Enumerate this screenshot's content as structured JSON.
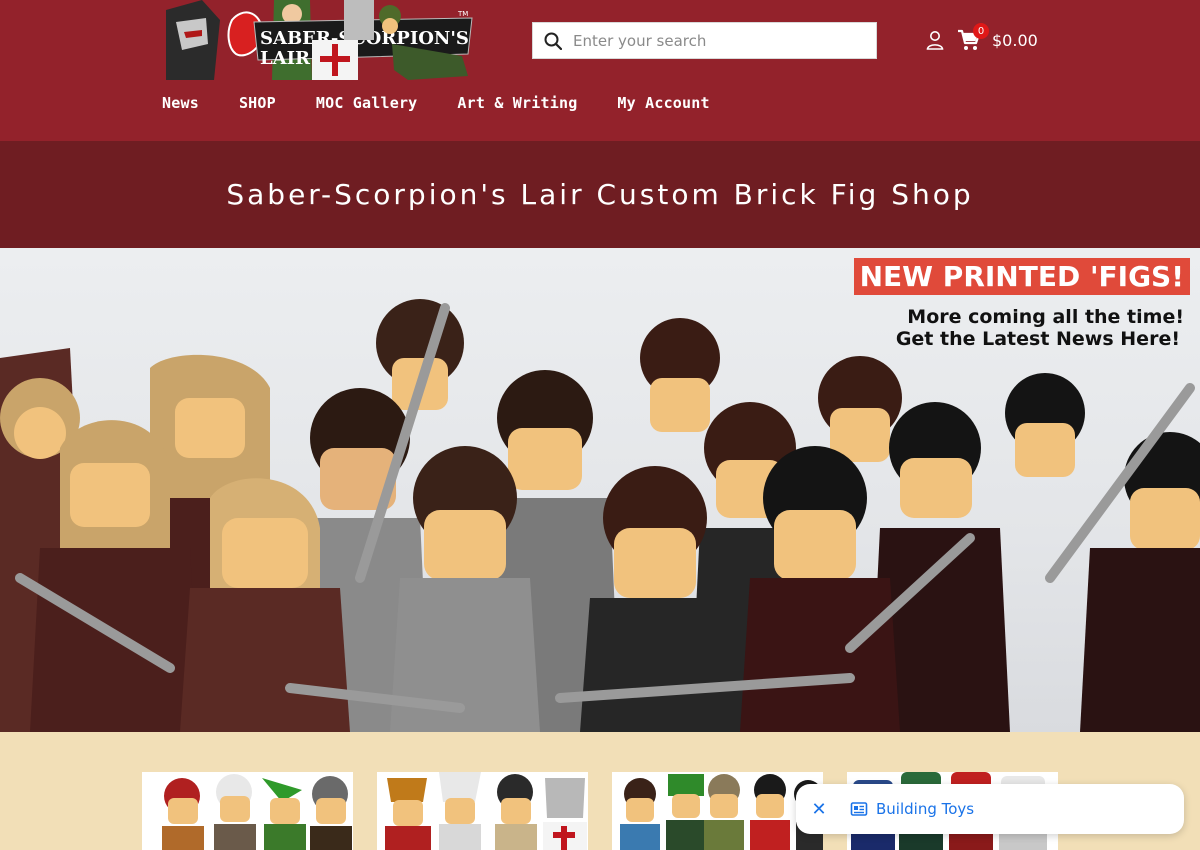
{
  "logo": {
    "text": "SABER-SCORPION'S",
    "subtext": "LAIR",
    "trademark": "TM"
  },
  "search": {
    "placeholder": "Enter your search",
    "value": ""
  },
  "cart": {
    "count": "0",
    "total": "$0.00"
  },
  "nav": {
    "items": [
      {
        "label": "News"
      },
      {
        "label": "SHOP"
      },
      {
        "label": "MOC Gallery"
      },
      {
        "label": "Art & Writing"
      },
      {
        "label": "My Account"
      }
    ]
  },
  "title_band": {
    "heading": "Saber-Scorpion's Lair Custom Brick Fig Shop"
  },
  "hero": {
    "badge": "NEW PRINTED 'FIGS!",
    "line1": "More coming all the time!",
    "line2": "Get the Latest News Here!"
  },
  "toast": {
    "label": "Building Toys"
  },
  "colors": {
    "header": "#93222b",
    "title_band": "#6f1d22",
    "page_bg": "#f2dfb7",
    "badge": "#e04a3a",
    "link_blue": "#1a73e8"
  }
}
